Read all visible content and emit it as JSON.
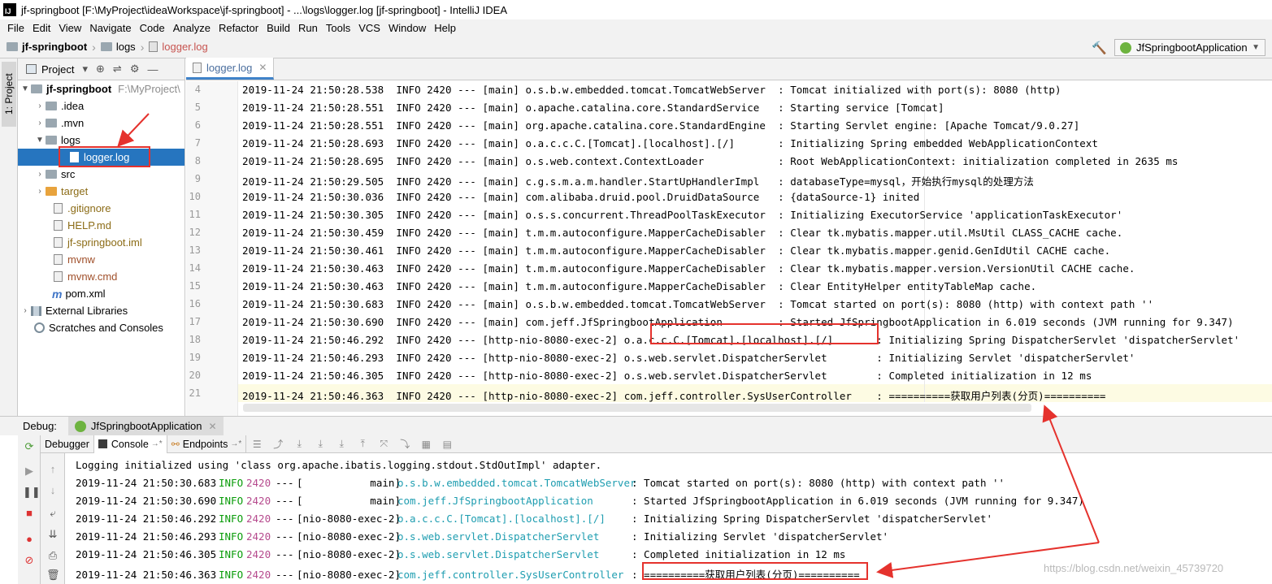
{
  "window": {
    "title": "jf-springboot [F:\\MyProject\\ideaWorkspace\\jf-springboot] - ...\\logs\\logger.log [jf-springboot] - IntelliJ IDEA",
    "app_icon_label": "IJ"
  },
  "menu": [
    "File",
    "Edit",
    "View",
    "Navigate",
    "Code",
    "Analyze",
    "Refactor",
    "Build",
    "Run",
    "Tools",
    "VCS",
    "Window",
    "Help"
  ],
  "breadcrumb": [
    "jf-springboot",
    "logs",
    "logger.log"
  ],
  "run_config": "JfSpringbootApplication",
  "left_stripe_tab": "1: Project",
  "project_panel": {
    "title": "Project",
    "tree": [
      {
        "label": "jf-springboot",
        "path": "F:\\MyProject\\",
        "icon": "folder-icon"
      },
      {
        "label": ".idea",
        "icon": "folder-icon"
      },
      {
        "label": ".mvn",
        "icon": "folder-icon"
      },
      {
        "label": "logs",
        "icon": "folder-icon"
      },
      {
        "label": "logger.log",
        "icon": "file-icon",
        "selected": true
      },
      {
        "label": "src",
        "icon": "folder-icon"
      },
      {
        "label": "target",
        "icon": "folder-orange-icon"
      },
      {
        "label": ".gitignore",
        "icon": "file-icon"
      },
      {
        "label": "HELP.md",
        "icon": "markdown-icon"
      },
      {
        "label": "jf-springboot.iml",
        "icon": "file-icon"
      },
      {
        "label": "mvnw",
        "icon": "file-icon"
      },
      {
        "label": "mvnw.cmd",
        "icon": "file-icon"
      },
      {
        "label": "pom.xml",
        "icon": "maven-icon"
      },
      {
        "label": "External Libraries",
        "icon": "library-icon"
      },
      {
        "label": "Scratches and Consoles",
        "icon": "scratch-icon"
      }
    ]
  },
  "editor": {
    "tab": "logger.log",
    "lines": [
      {
        "n": "4",
        "text": "2019-11-24 21:50:28.538  INFO 2420 --- [main] o.s.b.w.embedded.tomcat.TomcatWebServer  : Tomcat initialized with port(s): 8080 (http)"
      },
      {
        "n": "5",
        "text": "2019-11-24 21:50:28.551  INFO 2420 --- [main] o.apache.catalina.core.StandardService   : Starting service [Tomcat]"
      },
      {
        "n": "6",
        "text": "2019-11-24 21:50:28.551  INFO 2420 --- [main] org.apache.catalina.core.StandardEngine  : Starting Servlet engine: [Apache Tomcat/9.0.27]"
      },
      {
        "n": "7",
        "text": "2019-11-24 21:50:28.693  INFO 2420 --- [main] o.a.c.c.C.[Tomcat].[localhost].[/]       : Initializing Spring embedded WebApplicationContext"
      },
      {
        "n": "8",
        "text": "2019-11-24 21:50:28.695  INFO 2420 --- [main] o.s.web.context.ContextLoader            : Root WebApplicationContext: initialization completed in 2635 ms"
      },
      {
        "n": "9",
        "text": "2019-11-24 21:50:29.505  INFO 2420 --- [main] c.g.s.m.a.m.handler.StartUpHandlerImpl   : databaseType=mysql，开始执行mysql的处理方法"
      },
      {
        "n": "10",
        "text": "2019-11-24 21:50:30.036  INFO 2420 --- [main] com.alibaba.druid.pool.DruidDataSource   : {dataSource-1} inited"
      },
      {
        "n": "11",
        "text": "2019-11-24 21:50:30.305  INFO 2420 --- [main] o.s.s.concurrent.ThreadPoolTaskExecutor  : Initializing ExecutorService 'applicationTaskExecutor'"
      },
      {
        "n": "12",
        "text": "2019-11-24 21:50:30.459  INFO 2420 --- [main] t.m.m.autoconfigure.MapperCacheDisabler  : Clear tk.mybatis.mapper.util.MsUtil CLASS_CACHE cache."
      },
      {
        "n": "13",
        "text": "2019-11-24 21:50:30.461  INFO 2420 --- [main] t.m.m.autoconfigure.MapperCacheDisabler  : Clear tk.mybatis.mapper.genid.GenIdUtil CACHE cache."
      },
      {
        "n": "14",
        "text": "2019-11-24 21:50:30.463  INFO 2420 --- [main] t.m.m.autoconfigure.MapperCacheDisabler  : Clear tk.mybatis.mapper.version.VersionUtil CACHE cache."
      },
      {
        "n": "15",
        "text": "2019-11-24 21:50:30.463  INFO 2420 --- [main] t.m.m.autoconfigure.MapperCacheDisabler  : Clear EntityHelper entityTableMap cache."
      },
      {
        "n": "16",
        "text": "2019-11-24 21:50:30.683  INFO 2420 --- [main] o.s.b.w.embedded.tomcat.TomcatWebServer  : Tomcat started on port(s): 8080 (http) with context path ''"
      },
      {
        "n": "17",
        "text": "2019-11-24 21:50:30.690  INFO 2420 --- [main] com.jeff.JfSpringbootApplication         : Started JfSpringbootApplication in 6.019 seconds (JVM running for 9.347)"
      },
      {
        "n": "18",
        "text": "2019-11-24 21:50:46.292  INFO 2420 --- [http-nio-8080-exec-2] o.a.c.c.C.[Tomcat].[localhost].[/]       : Initializing Spring DispatcherServlet 'dispatcherServlet'"
      },
      {
        "n": "19",
        "text": "2019-11-24 21:50:46.293  INFO 2420 --- [http-nio-8080-exec-2] o.s.web.servlet.DispatcherServlet        : Initializing Servlet 'dispatcherServlet'"
      },
      {
        "n": "20",
        "text": "2019-11-24 21:50:46.305  INFO 2420 --- [http-nio-8080-exec-2] o.s.web.servlet.DispatcherServlet        : Completed initialization in 12 ms"
      },
      {
        "n": "21",
        "text": "2019-11-24 21:50:46.363  INFO 2420 --- [http-nio-8080-exec-2] com.jeff.controller.SysUserController    : ==========获取用户列表(分页)=========="
      }
    ]
  },
  "debug": {
    "label": "Debug:",
    "tab": "JfSpringbootApplication",
    "tabs": [
      "Debugger",
      "Console",
      "Endpoints"
    ],
    "console_first_line": "Logging initialized using 'class org.apache.ibatis.logging.stdout.StdOutImpl' adapter.",
    "console_lines": [
      {
        "ts": "2019-11-24 21:50:30.683",
        "level": "INFO",
        "pid": "2420",
        "sep": "---",
        "thread": "[           main]",
        "cls": "o.s.b.w.embedded.tomcat.TomcatWebServer",
        "msg": ": Tomcat started on port(s): 8080 (http) with context path ''"
      },
      {
        "ts": "2019-11-24 21:50:30.690",
        "level": "INFO",
        "pid": "2420",
        "sep": "---",
        "thread": "[           main]",
        "cls": "com.jeff.JfSpringbootApplication",
        "msg": ": Started JfSpringbootApplication in 6.019 seconds (JVM running for 9.347)"
      },
      {
        "ts": "2019-11-24 21:50:46.292",
        "level": "INFO",
        "pid": "2420",
        "sep": "---",
        "thread": "[nio-8080-exec-2]",
        "cls": "o.a.c.c.C.[Tomcat].[localhost].[/]",
        "msg": ": Initializing Spring DispatcherServlet 'dispatcherServlet'"
      },
      {
        "ts": "2019-11-24 21:50:46.293",
        "level": "INFO",
        "pid": "2420",
        "sep": "---",
        "thread": "[nio-8080-exec-2]",
        "cls": "o.s.web.servlet.DispatcherServlet",
        "msg": ": Initializing Servlet 'dispatcherServlet'"
      },
      {
        "ts": "2019-11-24 21:50:46.305",
        "level": "INFO",
        "pid": "2420",
        "sep": "---",
        "thread": "[nio-8080-exec-2]",
        "cls": "o.s.web.servlet.DispatcherServlet",
        "msg": ": Completed initialization in 12 ms"
      },
      {
        "ts": "2019-11-24 21:50:46.363",
        "level": "INFO",
        "pid": "2420",
        "sep": "---",
        "thread": "[nio-8080-exec-2]",
        "cls": "com.jeff.controller.SysUserController",
        "msg": ": ==========获取用户列表(分页)=========="
      }
    ]
  },
  "watermark": "https://blog.csdn.net/weixin_45739720",
  "colors": {
    "annotation": "#e5322d",
    "selection": "#2675bf",
    "info": "#0a9c0a",
    "pid": "#b64b8e",
    "logger": "#1e9db0"
  }
}
